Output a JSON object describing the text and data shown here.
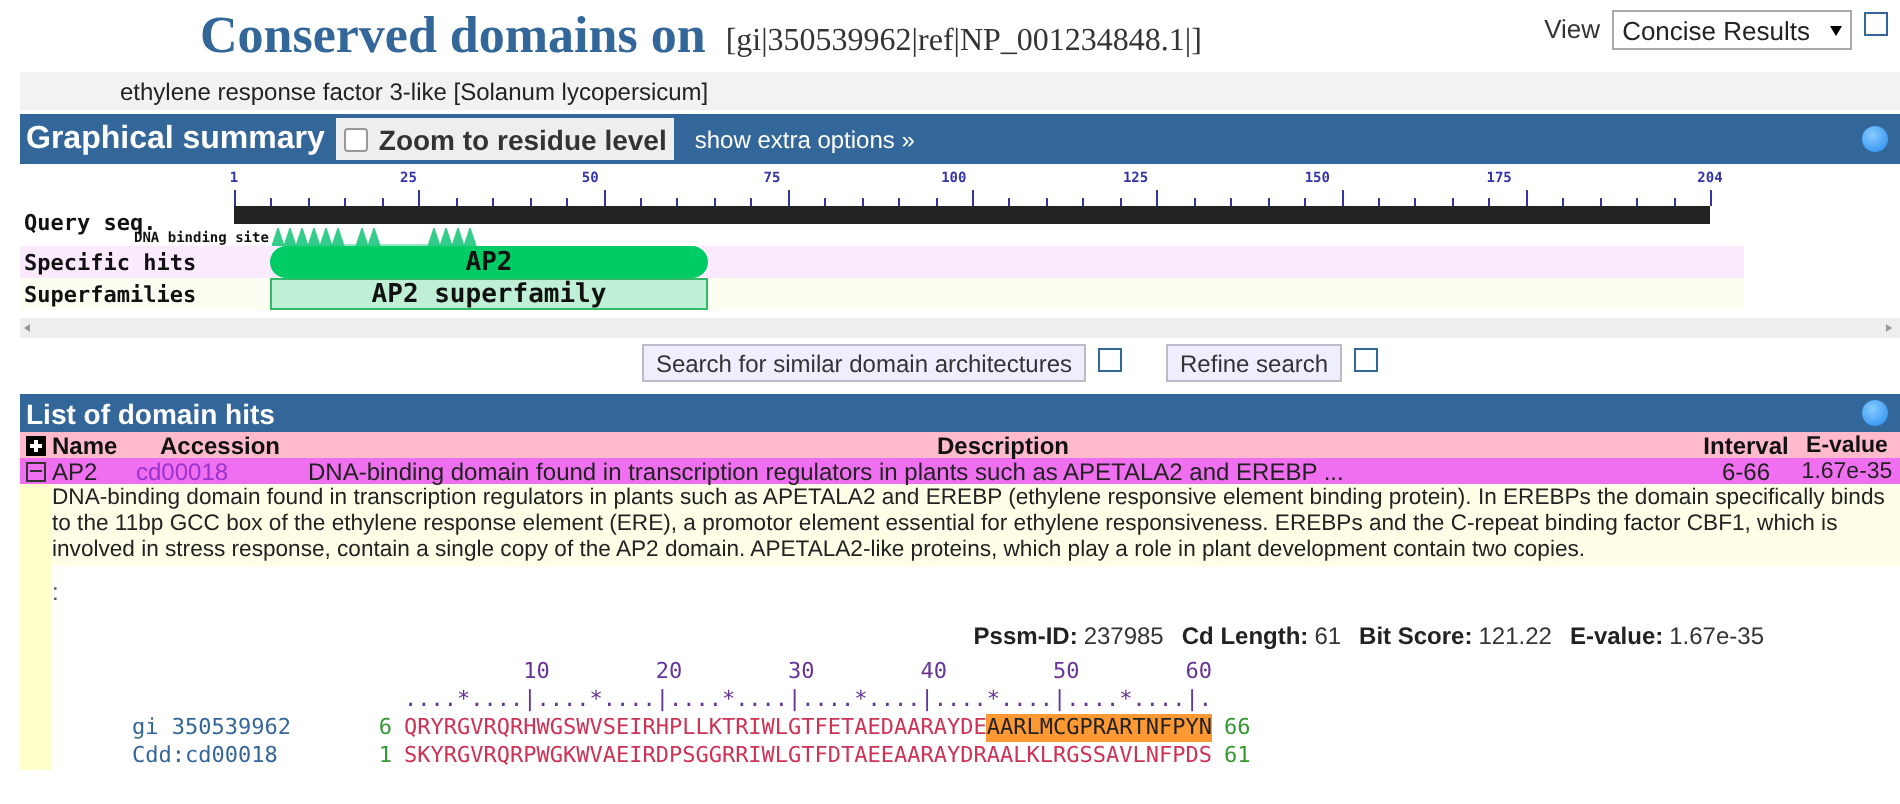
{
  "header": {
    "title": "Conserved domains on",
    "query_id": "[gi|350539962|ref|NP_001234848.1|]",
    "view_label": "View",
    "view_select": "Concise Results",
    "subtitle": "ethylene response factor 3-like [Solanum lycopersicum]"
  },
  "graphical_summary": {
    "title": "Graphical summary",
    "zoom_checkbox": {
      "label": "Zoom to residue level",
      "checked": false
    },
    "extra_options": "show extra options »",
    "ruler_ticks": [
      "1",
      "25",
      "50",
      "75",
      "100",
      "125",
      "150",
      "175",
      "204"
    ],
    "query_label": "Query seq.",
    "site_label": "DNA binding site",
    "tracks": [
      {
        "label": "Specific hits",
        "hit": "AP2",
        "kind": "specific"
      },
      {
        "label": "Superfamilies",
        "hit": "AP2 superfamily",
        "kind": "superfamily"
      }
    ]
  },
  "buttons": [
    {
      "label": "Search for similar domain architectures"
    },
    {
      "label": "Refine search"
    }
  ],
  "domain_hits": {
    "title": "List of domain hits",
    "columns": [
      "Name",
      "Accession",
      "Description",
      "Interval",
      "E-value"
    ],
    "rows": [
      {
        "name": "AP2",
        "accession": "cd00018",
        "description": "DNA-binding domain found in transcription regulators in plants such as APETALA2 and EREBP ...",
        "interval": "6-66",
        "evalue": "1.67e-35",
        "expanded": true,
        "details": {
          "text": "DNA-binding domain found in transcription regulators in plants such as APETALA2 and EREBP (ethylene responsive element binding protein). In EREBPs the domain specifically binds to the 11bp GCC box of the ethylene response element (ERE), a promotor element essential for ethylene responsiveness. EREBPs and the C-repeat binding factor CBF1, which is involved in stress response, contain a single copy of the AP2 domain. APETALA2-like proteins, which play a role in plant development contain two copies.",
          "colon": ":",
          "stats": [
            {
              "label": "Pssm-ID:",
              "value": "237985"
            },
            {
              "label": "Cd Length:",
              "value": "61"
            },
            {
              "label": "Bit Score:",
              "value": "121.22"
            },
            {
              "label": "E-value:",
              "value": "1.67e-35"
            }
          ],
          "ruler_numbers": "         10        20        30        40        50        60",
          "ruler_marks": "....*....|....*....|....*....|....*....|....*....|....*....|.",
          "alignment": [
            {
              "id": "gi 350539962",
              "start": "6",
              "sequence": "QRYRGVRQRHWGSWVSEIRHPLLKTRIWLGTFETAEDAARAYDE",
              "highlight": "AARLMCGPRARTNFPYN",
              "end": "66"
            },
            {
              "id": "Cdd:cd00018",
              "start": "1",
              "sequence": "SKYRGVRQRPWGKWVAEIRDPSGGRRIWLGTFDTAEEAARAYDRAALKLRGSSAVLNFPDS",
              "end": "61"
            }
          ]
        }
      }
    ]
  }
}
